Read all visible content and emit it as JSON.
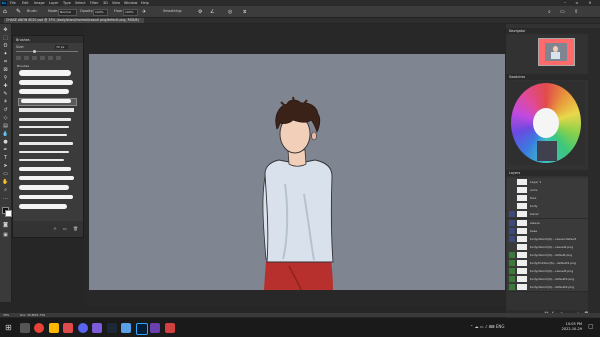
{
  "app": {
    "title": "Photoshop"
  },
  "menu": [
    "File",
    "Edit",
    "Image",
    "Layer",
    "Type",
    "Select",
    "Filter",
    "3D",
    "View",
    "Window",
    "Help"
  ],
  "options_bar": {
    "size_label": "Brush:",
    "mode_label": "Mode:",
    "mode_value": "Normal",
    "opacity_label": "Opacity:",
    "opacity_value": "100%",
    "flow_label": "Flow:",
    "flow_value": "100%",
    "smoothing_label": "Smoothing:"
  },
  "document_tab": {
    "title": "CHASE ANON 8020.psd @ 33% (body/stand/normal/casual.png/default.png, RGB/8)"
  },
  "brushes_panel": {
    "title": "Brushes",
    "size_label": "Size:",
    "size_value": "70 px",
    "group_label": "Brushes"
  },
  "panels": {
    "navigator": "Navigator",
    "swatches": "Swatches",
    "layers": "Layers",
    "blend_mode": "Pass Through",
    "opacity_label": "Opacity:",
    "opacity_value": "100%"
  },
  "layers": [
    {
      "name": "Layer 1",
      "color": "#3a3a3a"
    },
    {
      "name": "arms",
      "color": "#3a3a3a"
    },
    {
      "name": "face",
      "color": "#3a3a3a"
    },
    {
      "name": "body",
      "color": "#3a3a3a"
    },
    {
      "name": "blend",
      "color": "#3b4a7a"
    },
    {
      "name": "sleeve",
      "color": "#3b4a7a"
    },
    {
      "name": "base",
      "color": "#3b4a7a"
    },
    {
      "name": "body/stand/(S)...casual default",
      "color": "#3b4a7a"
    },
    {
      "name": "body/stand/(S)...casual2.png",
      "color": "#3a3a3a"
    },
    {
      "name": "body/stand/(S)...default.png",
      "color": "#3a7a3a"
    },
    {
      "name": "body/hidden/(S)...default2.png",
      "color": "#3a7a3a"
    },
    {
      "name": "body/stand/(S)...casual3.png",
      "color": "#3a7a3a"
    },
    {
      "name": "body/stand/(S)...default3.png",
      "color": "#3a7a3a"
    },
    {
      "name": "body/stand/(S)...default4.png",
      "color": "#3a7a3a"
    }
  ],
  "status_bar": {
    "zoom": "33%",
    "doc": "Doc: 45.8M/1.73G"
  },
  "taskbar": {
    "time": "10:05 PM",
    "date": "2022-10-29"
  },
  "colors": {
    "canvas_bg": "#7f8591",
    "shirt": "#d9e2ec",
    "pants": "#b8302d",
    "hair": "#3b2218",
    "skin": "#f2cfb8"
  }
}
